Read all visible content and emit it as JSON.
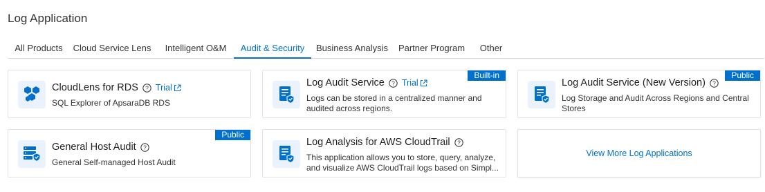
{
  "page": {
    "title": "Log Application"
  },
  "tabs": [
    {
      "label": "All Products"
    },
    {
      "label": "Cloud Service Lens"
    },
    {
      "label": "Intelligent O&M"
    },
    {
      "label": "Audit & Security"
    },
    {
      "label": "Business Analysis"
    },
    {
      "label": "Partner Program"
    },
    {
      "label": "Other"
    }
  ],
  "active_tab": "Audit & Security",
  "cards": [
    {
      "title": "CloudLens for RDS",
      "trial": "Trial",
      "desc": "SQL Explorer of ApsaraDB RDS",
      "badge": "",
      "icon": "cloudlens-hexagon-icon"
    },
    {
      "title": "Log Audit Service",
      "trial": "Trial",
      "desc_line1": "Logs can be stored in a centralized manner and",
      "desc_line2": "audited across regions.",
      "badge": "Built-in",
      "icon": "log-audit-document-icon"
    },
    {
      "title": "Log Audit Service (New Version)",
      "desc_line1": "Log Storage and Audit Across Regions and Central",
      "desc_line2": "Stores",
      "badge": "Public",
      "icon": "log-audit-document-icon"
    },
    {
      "title": "General Host Audit",
      "desc": "General Self-managed Host Audit",
      "badge": "Public",
      "icon": "host-audit-server-icon"
    },
    {
      "title": "Log Analysis for AWS CloudTrail",
      "desc_line1": "This application allows you to store, query, analyze,",
      "desc_line2": "and visualize AWS CloudTrail logs based on Simpl...",
      "icon": "log-analysis-document-icon"
    }
  ],
  "more": {
    "label": "View More Log Applications"
  },
  "colors": {
    "accent": "#0070cc",
    "icon_bg": "#eaf3fd",
    "border": "#e3e3e3"
  }
}
